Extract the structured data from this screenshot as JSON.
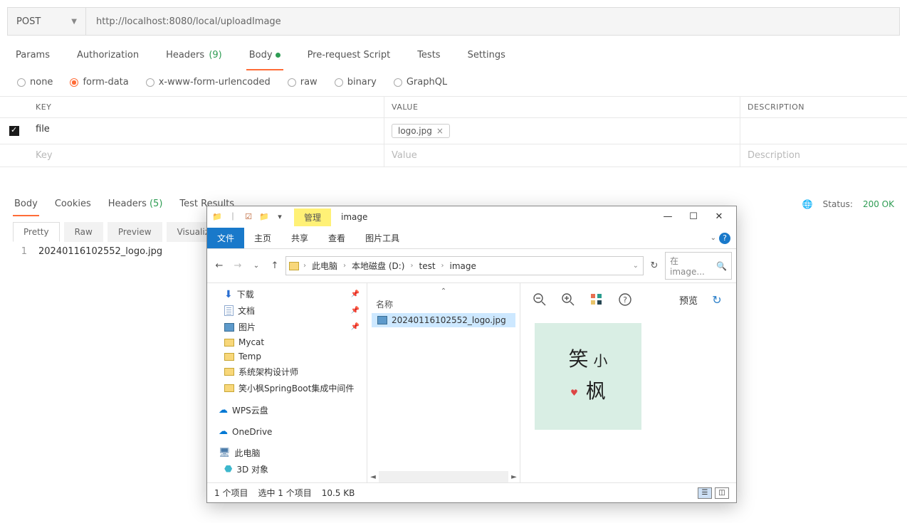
{
  "request": {
    "method": "POST",
    "url": "http://localhost:8080/local/uploadImage"
  },
  "tabs": {
    "params": "Params",
    "authorization": "Authorization",
    "headers": "Headers",
    "headers_count": "(9)",
    "body": "Body",
    "prerequest": "Pre-request Script",
    "tests": "Tests",
    "settings": "Settings"
  },
  "body_types": {
    "none": "none",
    "formdata": "form-data",
    "urlenc": "x-www-form-urlencoded",
    "raw": "raw",
    "binary": "binary",
    "graphql": "GraphQL"
  },
  "form_table": {
    "h_key": "KEY",
    "h_value": "VALUE",
    "h_desc": "DESCRIPTION",
    "row_key": "file",
    "row_value_file": "logo.jpg",
    "ph_key": "Key",
    "ph_value": "Value",
    "ph_desc": "Description"
  },
  "response": {
    "tabs": {
      "body": "Body",
      "cookies": "Cookies",
      "headers": "Headers",
      "headers_count": "(5)",
      "testresults": "Test Results"
    },
    "status_label": "Status:",
    "status_value": "200 OK",
    "viewtabs": {
      "pretty": "Pretty",
      "raw": "Raw",
      "preview": "Preview",
      "visualize": "Visualize"
    },
    "line1": "20240116102552_logo.jpg"
  },
  "explorer": {
    "manage_tab": "管理",
    "title": "image",
    "ribbon": {
      "file": "文件",
      "home": "主页",
      "share": "共享",
      "view": "查看",
      "pictools": "图片工具"
    },
    "breadcrumb": {
      "pc": "此电脑",
      "disk": "本地磁盘 (D:)",
      "test": "test",
      "image": "image"
    },
    "search_placeholder": "在 image...",
    "tree": {
      "downloads": "下载",
      "documents": "文档",
      "pictures": "图片",
      "mycat": "Mycat",
      "temp": "Temp",
      "arch": "系统架构设计师",
      "spring": "笑小枫SpringBoot集成中间件",
      "wps": "WPS云盘",
      "onedrive": "OneDrive",
      "thispc": "此电脑",
      "obj3d": "3D 对象"
    },
    "list": {
      "name_header": "名称",
      "file": "20240116102552_logo.jpg"
    },
    "preview_label": "预览",
    "status": {
      "count": "1 个项目",
      "selected": "选中 1 个项目",
      "size": "10.5 KB"
    }
  }
}
